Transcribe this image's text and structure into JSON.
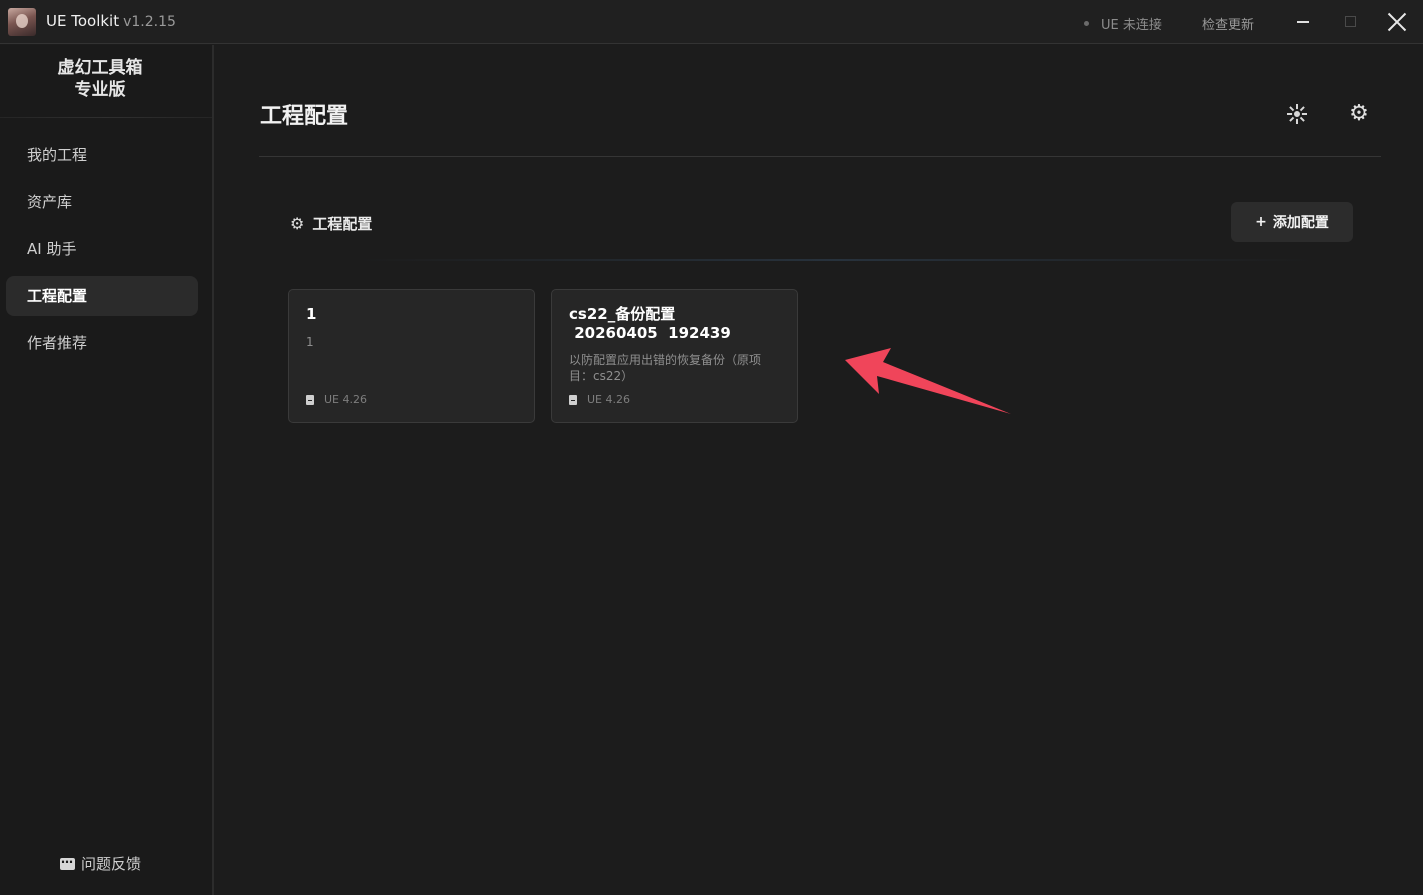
{
  "titlebar": {
    "app_name": "UE Toolkit",
    "version": "v1.2.15",
    "ue_status": "UE 未连接",
    "check_update": "检查更新"
  },
  "sidebar": {
    "brand_line1": "虚幻工具箱",
    "brand_line2": "专业版",
    "items": [
      {
        "label": "我的工程",
        "active": false
      },
      {
        "label": "资产库",
        "active": false
      },
      {
        "label": "AI 助手",
        "active": false
      },
      {
        "label": "工程配置",
        "active": true
      },
      {
        "label": "作者推荐",
        "active": false
      }
    ],
    "feedback": "问题反馈"
  },
  "main": {
    "page_title": "工程配置",
    "section_title": "工程配置",
    "add_button": "添加配置",
    "add_icon": "+",
    "cards": [
      {
        "title": "1",
        "description": "1",
        "version": "UE 4.26"
      },
      {
        "title": "cs22_备份配置\n 20260405  192439",
        "description": "以防配置应用出错的恢复备份（原项目：cs22）",
        "version": "UE 4.26"
      }
    ]
  },
  "colors": {
    "background": "#1c1c1c",
    "sidebar": "#1a1a1a",
    "card": "#262626",
    "arrow": "#f0455a"
  }
}
